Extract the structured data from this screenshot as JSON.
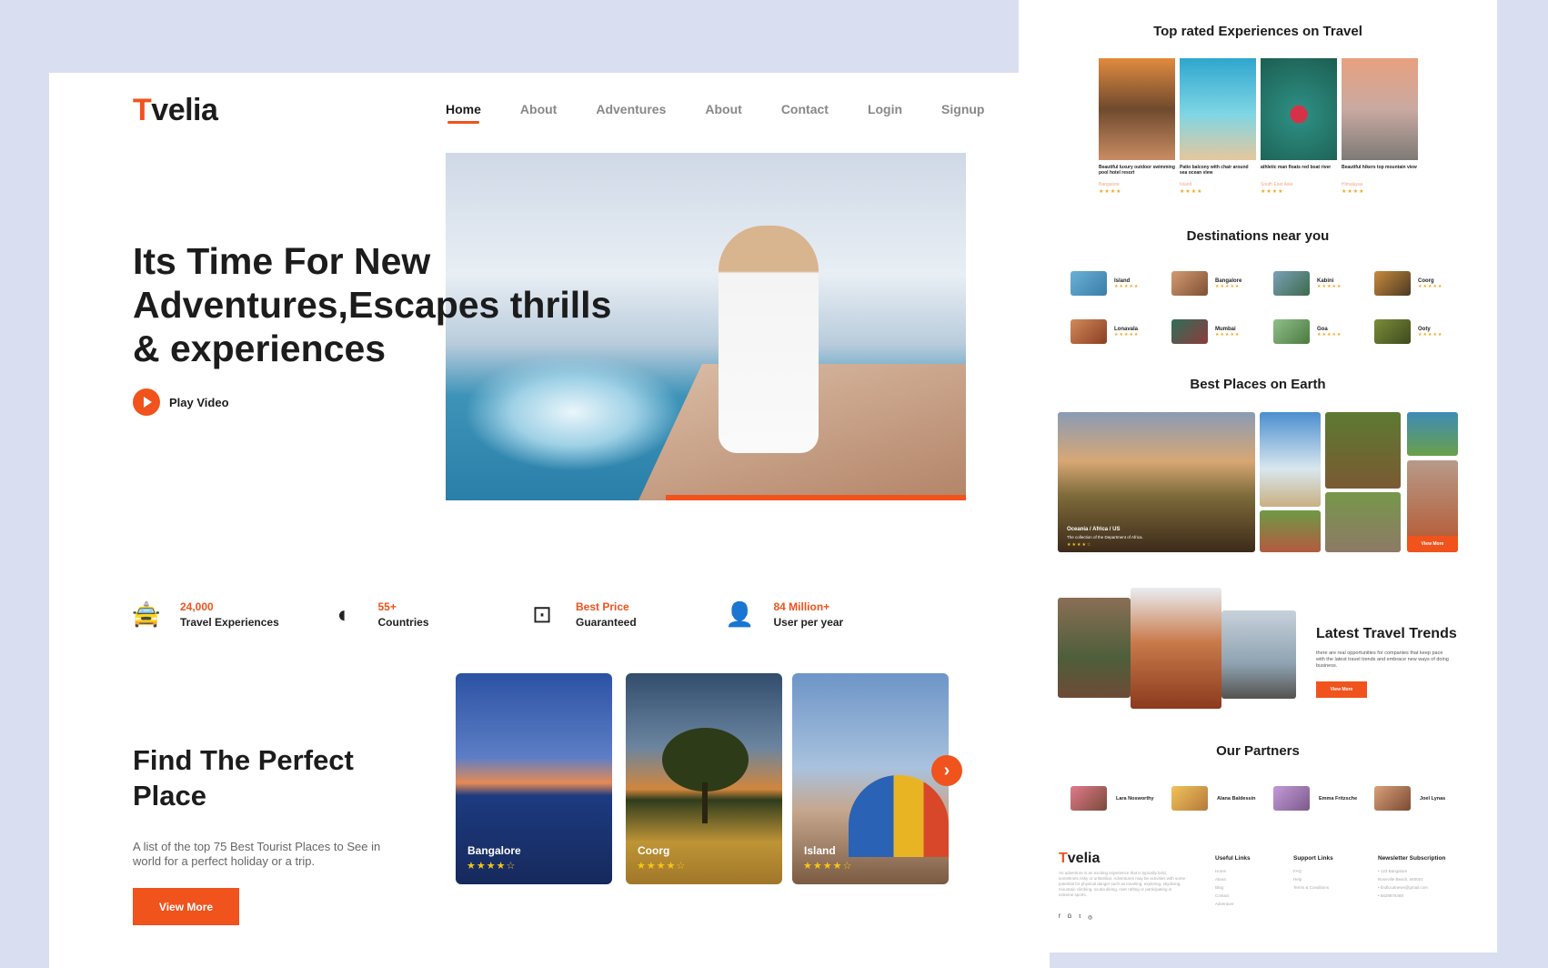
{
  "brand": {
    "first": "T",
    "rest": "velia"
  },
  "nav": [
    "Home",
    "About",
    "Adventures",
    "About",
    "Contact",
    "Login",
    "Signup"
  ],
  "hero": {
    "title": "Its Time For New Adventures,Escapes thrills & experiences",
    "play_label": "Play Video"
  },
  "stats": [
    {
      "value": "24,000",
      "label": "Travel Experiences",
      "icon": "car-icon"
    },
    {
      "value": "55+",
      "label": "Countries",
      "icon": "globe-icon"
    },
    {
      "value": "Best Price",
      "label": "Guaranteed",
      "icon": "money-icon"
    },
    {
      "value": "84 Million+",
      "label": "User per year",
      "icon": "user-icon"
    }
  ],
  "find": {
    "title": "Find The Perfect Place",
    "desc": "A list of the top 75 Best Tourist Places to See in world for a perfect holiday or a trip.",
    "button": "View More"
  },
  "cards": [
    {
      "name": "Bangalore",
      "stars": "★★★★☆",
      "rating": 4
    },
    {
      "name": "Coorg",
      "stars": "★★★★☆",
      "rating": 4
    },
    {
      "name": "Island",
      "stars": "★★★★☆",
      "rating": 4
    }
  ],
  "side": {
    "top_rated_title": "Top rated Experiences on Travel",
    "top_rated": [
      {
        "caption": "Beautiful luxury outdoor swimming pool hotel resort",
        "place": "Bangalore",
        "stars": "★★★★"
      },
      {
        "caption": "Patio balcony with chair around sea ocean view",
        "place": "Island",
        "stars": "★★★★"
      },
      {
        "caption": "athletic man floats red boat river",
        "place": "South East Asia",
        "stars": "★★★★"
      },
      {
        "caption": "Beautiful hikers top mountain view",
        "place": "Himalayas",
        "stars": "★★★★"
      }
    ],
    "destinations_title": "Destinations near you",
    "destinations": [
      {
        "name": "Island",
        "stars": "★★★★★"
      },
      {
        "name": "Bangalore",
        "stars": "★★★★★"
      },
      {
        "name": "Kabini",
        "stars": "★★★★★"
      },
      {
        "name": "Coorg",
        "stars": "★★★★★"
      },
      {
        "name": "Lonavala",
        "stars": "★★★★★"
      },
      {
        "name": "Mumbai",
        "stars": "★★★★★"
      },
      {
        "name": "Goa",
        "stars": "★★★★★"
      },
      {
        "name": "Ooty",
        "stars": "★★★★★"
      }
    ],
    "best_places_title": "Best Places on Earth",
    "best_places_caption": "Oceania / Africa / US",
    "best_places_sub": "The collection of the Department of Africa.",
    "best_places_stars": "★★★★☆",
    "best_places_button": "View More",
    "trends_title": "Latest Travel Trends",
    "trends_desc": "there are real opportunities for companies that keep pace with the latest travel trends and embrace new ways of doing business.",
    "trends_button": "View More",
    "partners_title": "Our Partners",
    "partners": [
      "Lara Nosworthy",
      "Alana Baldessin",
      "Emma Fritzsche",
      "Joel Lynas"
    ],
    "footer": {
      "desc": "An adventure is an exciting experience that is typically bold, sometimes risky or unfamiliar. Adventures may be activities with some potential for physical danger such as traveling, exploring, skydiving, mountain climbing, scuba diving, river rafting or participating in extreme sports.",
      "social": [
        "f",
        "G",
        "t",
        "◎"
      ],
      "useful_title": "Useful Links",
      "useful": [
        "Home",
        "About",
        "Blog",
        "Contact",
        "Adventure"
      ],
      "support_title": "Support Links",
      "support": [
        "FAQ",
        "Help",
        "Terms & Conditions"
      ],
      "news_title": "Newsletter Subscription",
      "news": [
        "• 123 Bangalore",
        "  Roseville Beach, 560001",
        "• findlocalnews@gmail.com",
        "• 5629876489"
      ]
    }
  },
  "colors": {
    "accent": "#f0531c",
    "background": "#d9dff0",
    "star": "#f5c518"
  }
}
